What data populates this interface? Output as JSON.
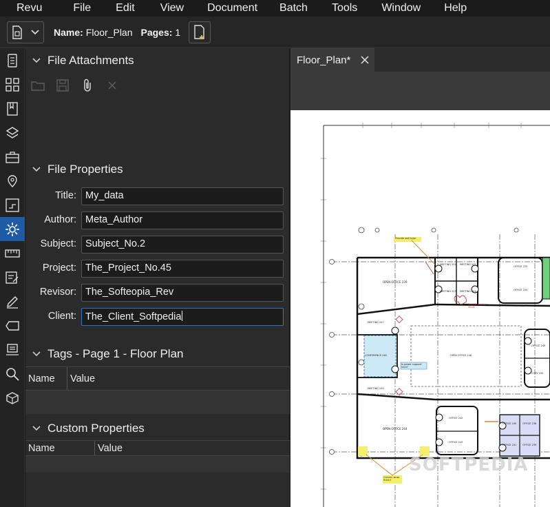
{
  "menu": [
    "Revu",
    "File",
    "Edit",
    "View",
    "Document",
    "Batch",
    "Tools",
    "Window",
    "Help"
  ],
  "toolbar": {
    "name_label": "Name:",
    "name_value": "Floor_Plan",
    "pages_label": "Pages:",
    "pages_value": "1"
  },
  "rail": [
    "thumbnails-icon",
    "grid-icon",
    "bookmarks-icon",
    "layers-icon",
    "toolchest-icon",
    "places-icon",
    "markup-icon",
    "properties-icon",
    "measure-icon",
    "form-icon",
    "signature-icon",
    "tag-icon",
    "studio-icon",
    "search-icon",
    "3d-icon"
  ],
  "panel": {
    "attachments_title": "File Attachments",
    "properties_title": "File Properties",
    "properties": [
      {
        "label": "Title:",
        "value": "My_data"
      },
      {
        "label": "Author:",
        "value": "Meta_Author"
      },
      {
        "label": "Subject:",
        "value": "Subject_No.2"
      },
      {
        "label": "Project:",
        "value": "The_Project_No.45"
      },
      {
        "label": "Revisor:",
        "value": "The_Softeopia_Rev"
      },
      {
        "label": "Client:",
        "value": "The_Client_Softpedia"
      }
    ],
    "tags_title": "Tags - Page 1 - Floor Plan",
    "tags_columns": [
      "Name",
      "Value"
    ],
    "custom_title": "Custom Properties",
    "custom_columns": [
      "Name",
      "Value"
    ]
  },
  "document": {
    "tab_title": "Floor_Plan*",
    "watermark": "SOFTPEDIA",
    "rooms": [
      "OPEN OFFICE 239",
      "MEETING 201",
      "MEETING 203",
      "MEETING 202",
      "MEETING 204",
      "OFFICE 235",
      "OFFICE 234",
      "MEETING 247",
      "CONFERENCE 246",
      "MEETING 245",
      "OPEN OFFICE 248",
      "OFFICE 249",
      "COPY 250",
      "OPEN OFFICE 244",
      "OFFICE 242",
      "OFFICE 243",
      "OFFICE 240",
      "OFFICE 238",
      "OFFICE 241",
      "OFFICE 239"
    ],
    "notes": [
      "Provide wall type",
      "Provide marker recall",
      "Is power support here?",
      "Column wrap finish?"
    ]
  },
  "colors": {
    "accent": "#1f5aa6",
    "focus_border": "#2f75c8",
    "conference_fill": "#cde8f6",
    "office_fill": "#d9dcf5",
    "note_red": "#d23b3b",
    "note_yellow": "#f3ef6a",
    "green_room": "#6fcf7a"
  }
}
